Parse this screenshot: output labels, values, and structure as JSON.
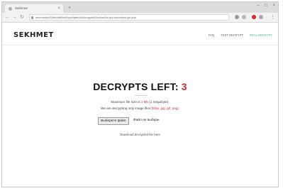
{
  "browser": {
    "tab_title": "Sekhmet",
    "new_tab": "+",
    "close_tab": "×",
    "address": "sekhmetqdi7b6ndrtlr5eb2vpe6qttel4t4clzvqynbk3zn4ws2euyd.onion/decrypt.php",
    "window_controls": [
      "–",
      "□",
      "×"
    ]
  },
  "site": {
    "brand": "SEKHMET",
    "nav": [
      {
        "label": "FAQ",
        "active": false
      },
      {
        "label": "TEST DECRYPT",
        "active": false
      },
      {
        "label": "REAL DECRYPT",
        "active": true
      }
    ]
  },
  "main": {
    "title_prefix": "DECRYPTS LEFT:",
    "count": "3",
    "max_size_text": "Maximum file size is ",
    "max_size_value": "1 Mb",
    "max_size_suffix": " (1 megabyte).",
    "types_text": "We are decrypting only image files ",
    "types_value": "(bmp, jpg, gif, png).",
    "choose_button": "Выберите файл",
    "no_file": "Файл не выбран",
    "download": "Download decrypted file here"
  },
  "colors": {
    "accent_red": "#d62728",
    "nav_active": "#4fb38b"
  }
}
